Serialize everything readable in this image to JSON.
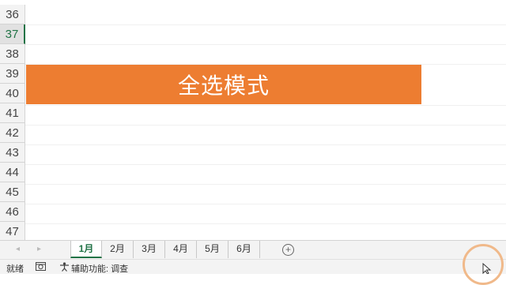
{
  "rows": [
    "36",
    "37",
    "38",
    "39",
    "40",
    "41",
    "42",
    "43",
    "44",
    "45",
    "46",
    "47"
  ],
  "active_row": "37",
  "banner": {
    "text": "全选模式",
    "color": "#ed7d31"
  },
  "sheet_tabs": [
    "1月",
    "2月",
    "3月",
    "4月",
    "5月",
    "6月"
  ],
  "active_tab": "1月",
  "add_sheet_symbol": "+",
  "nav_left": "◂",
  "nav_right": "▸",
  "status": {
    "ready": "就绪",
    "accessibility": "辅助功能: 调查"
  },
  "icons": {
    "macro": "macro-record-icon",
    "accessibility": "accessibility-icon"
  },
  "accent_color": "#217346"
}
